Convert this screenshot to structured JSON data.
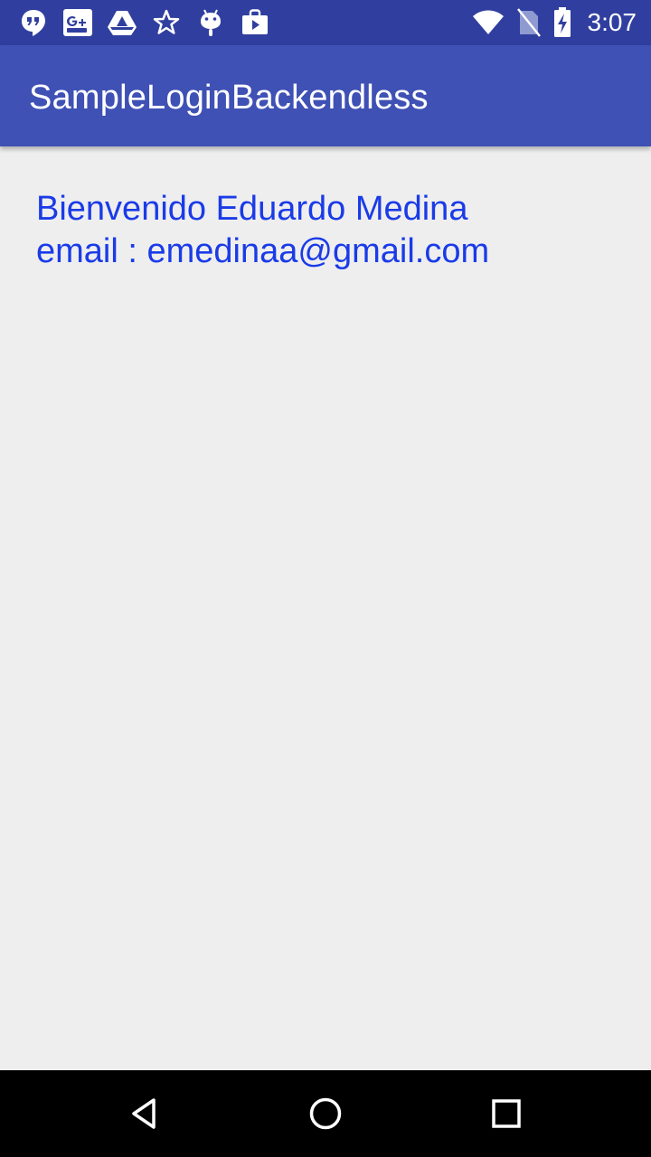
{
  "status_bar": {
    "time": "3:07",
    "notification_icons": [
      "hangouts-icon",
      "google-plus-icon",
      "drive-icon",
      "star-icon",
      "android-icon",
      "play-store-icon"
    ],
    "system_icons": [
      "wifi-icon",
      "no-sim-icon",
      "battery-charging-icon"
    ],
    "background_color": "#303f9f"
  },
  "app_bar": {
    "title": "SampleLoginBackendless",
    "background_color": "#3f51b5"
  },
  "main": {
    "welcome_line": "Bienvenido Eduardo Medina",
    "email_line": "email : emedinaa@gmail.com",
    "text_color": "#1a3be8",
    "background_color": "#eeeeee"
  },
  "nav_bar": {
    "buttons": [
      "back-icon",
      "home-icon",
      "recents-icon"
    ],
    "background_color": "#000000"
  }
}
